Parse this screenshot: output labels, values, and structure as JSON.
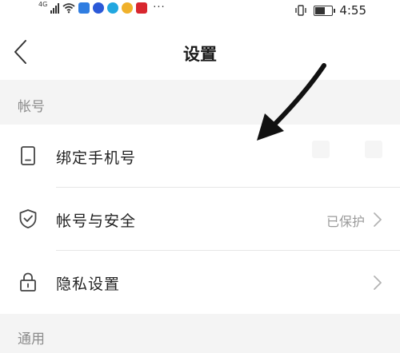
{
  "status_bar": {
    "network": "4G",
    "time": "4:55",
    "battery_level": 0.6,
    "app_icons": [
      "wifi-icon",
      "shield-app-icon",
      "baidu-app-icon",
      "qq-browser-app-icon",
      "weibo-app-icon",
      "red-app-icon"
    ],
    "overflow": "···"
  },
  "nav": {
    "title": "设置",
    "back_icon": "chevron-left-icon"
  },
  "sections": {
    "account": {
      "header": "帐号",
      "items": [
        {
          "label": "绑定手机号",
          "icon": "phone-icon",
          "value": ""
        },
        {
          "label": "帐号与安全",
          "icon": "shield-check-icon",
          "value": "已保护"
        },
        {
          "label": "隐私设置",
          "icon": "lock-icon",
          "value": ""
        }
      ]
    },
    "general": {
      "header": "通用"
    }
  },
  "colors": {
    "background": "#f4f4f4",
    "card": "#ffffff",
    "section_text": "#8c8c8c",
    "value_text": "#9a9a9a",
    "icon": "#444444"
  }
}
